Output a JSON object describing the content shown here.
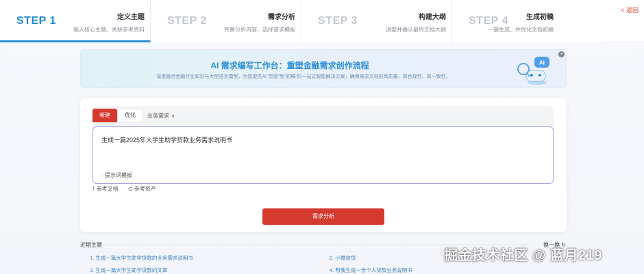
{
  "steps": [
    {
      "num": "STEP 1",
      "title": "定义主题",
      "desc": "输入核心主题、关联参考资料"
    },
    {
      "num": "STEP 2",
      "title": "需求分析",
      "desc": "完善分析内容、选择需求模板"
    },
    {
      "num": "STEP 3",
      "title": "构建大纲",
      "desc": "调整并确认最终文档大纲"
    },
    {
      "num": "STEP 4",
      "title": "生成初稿",
      "desc": "一键生成、并优化文档初稿"
    }
  ],
  "back_label": "< 返回",
  "banner": {
    "title": "AI 需求编写工作台：重塑金融需求创作流程",
    "subtitle": "深度融合金融行业知识与大型语言模型，为您提供从“灵感”到“初稿”的一站式智能解决方案，确保需求文档的高质量、高合规性、高一致性。",
    "robot_text": "AI",
    "close_label": "×"
  },
  "editor": {
    "tabs": [
      "新建",
      "优化"
    ],
    "type_select": "业务需求",
    "text": "生成一篇2025年大学生助学贷款业务需求说明书",
    "template_button": "提示词模板"
  },
  "refs": {
    "doc": "参考文档",
    "asset": "参考资产"
  },
  "analyze_button": "需求分析",
  "recent": {
    "label": "近期主题",
    "refresh": "换一换",
    "items": [
      "1. 生成一篇大学生助学贷款的业务需求说明书",
      "2. 小微信贷",
      "3. 生成一篇大学生助学贷款的文章",
      "4. 帮我生成一份个人贷款业务说明书"
    ]
  },
  "watermark": "掘金技术社区 @ 蓝月219",
  "colors": {
    "accent_blue": "#1e8ad6",
    "accent_red": "#d53a2f",
    "link_blue": "#3b82c4"
  }
}
